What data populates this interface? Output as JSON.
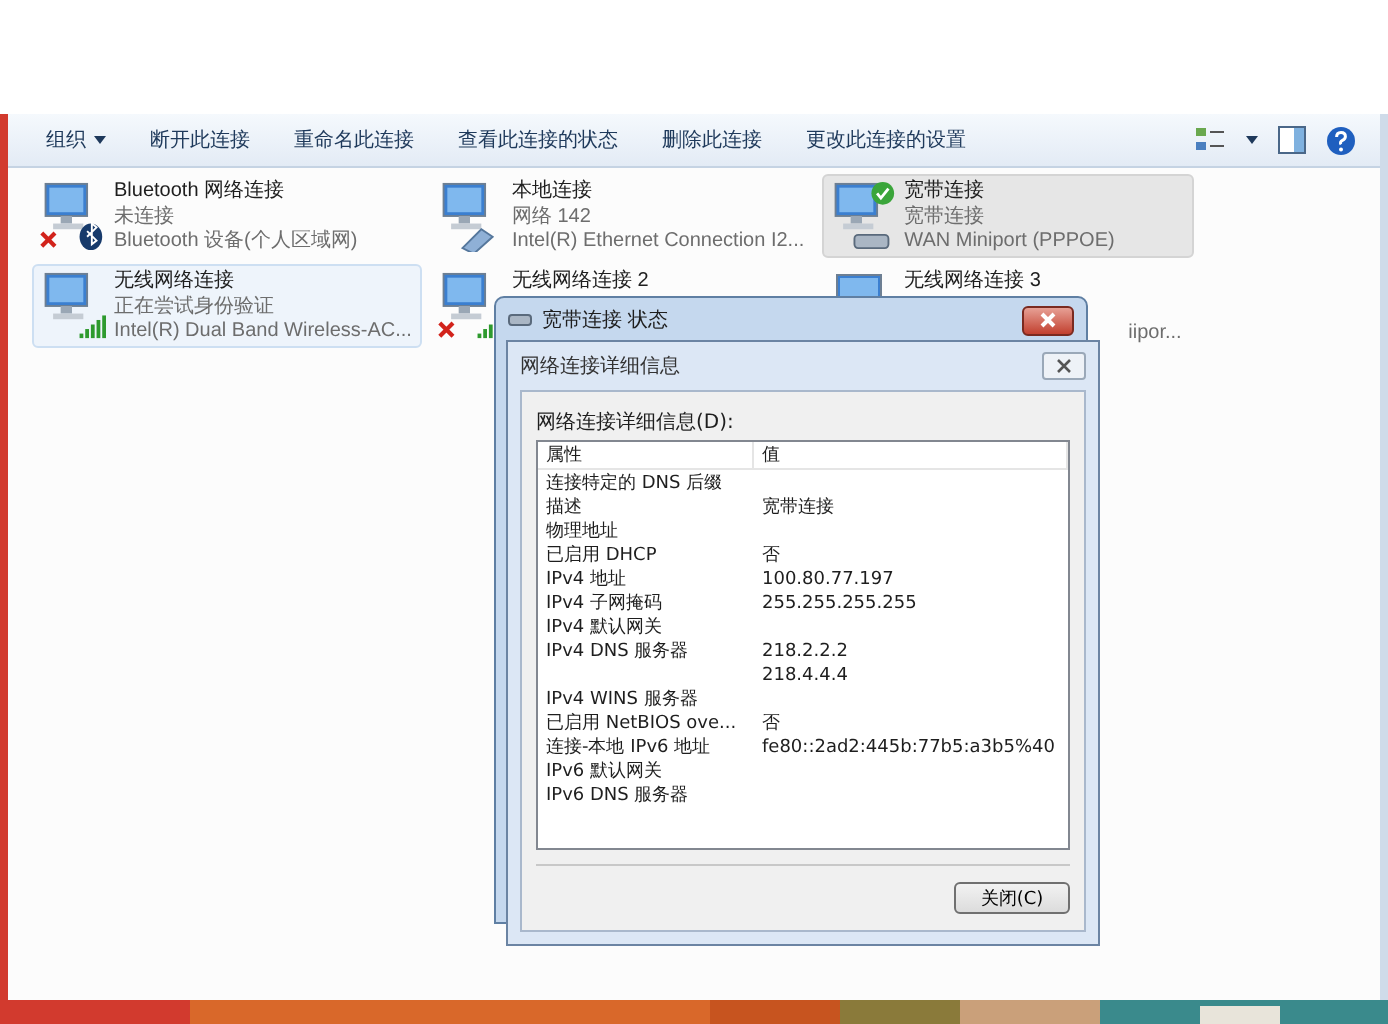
{
  "toolbar": {
    "items": [
      {
        "label": "组织",
        "dropdown": true
      },
      {
        "label": "断开此连接",
        "dropdown": false
      },
      {
        "label": "重命名此连接",
        "dropdown": false
      },
      {
        "label": "查看此连接的状态",
        "dropdown": false
      },
      {
        "label": "删除此连接",
        "dropdown": false
      },
      {
        "label": "更改此连接的设置",
        "dropdown": false
      }
    ]
  },
  "connections": [
    {
      "name": "Bluetooth 网络连接",
      "status": "未连接",
      "device": "Bluetooth 设备(个人区域网)",
      "kind": "bluetooth",
      "disconnected": true,
      "selected": false
    },
    {
      "name": "本地连接",
      "status": "网络  142",
      "device": "Intel(R) Ethernet Connection I2...",
      "kind": "ethernet",
      "disconnected": false,
      "selected": false
    },
    {
      "name": "宽带连接",
      "status": "宽带连接",
      "device": "WAN Miniport (PPPOE)",
      "kind": "broadband",
      "disconnected": false,
      "selected": true
    },
    {
      "name": "无线网络连接",
      "status": "正在尝试身份验证",
      "device": "Intel(R) Dual Band Wireless-AC...",
      "kind": "wireless",
      "disconnected": false,
      "selected": true
    },
    {
      "name": "无线网络连接 2",
      "kind": "wireless",
      "disconnected": true,
      "selected": false
    },
    {
      "name": "无线网络连接 3",
      "device_tail": "iipor...",
      "kind": "wireless"
    }
  ],
  "status_window": {
    "title": "宽带连接 状态"
  },
  "details_dialog": {
    "title": "网络连接详细信息",
    "list_label": "网络连接详细信息(D):",
    "columns": [
      "属性",
      "值"
    ],
    "rows": [
      {
        "property": "连接特定的 DNS 后缀",
        "value": ""
      },
      {
        "property": "描述",
        "value": "宽带连接"
      },
      {
        "property": "物理地址",
        "value": ""
      },
      {
        "property": "已启用 DHCP",
        "value": "否"
      },
      {
        "property": "IPv4 地址",
        "value": "100.80.77.197"
      },
      {
        "property": "IPv4 子网掩码",
        "value": "255.255.255.255"
      },
      {
        "property": "IPv4 默认网关",
        "value": ""
      },
      {
        "property": "IPv4 DNS 服务器",
        "value": "218.2.2.2"
      },
      {
        "property": "",
        "value": "218.4.4.4"
      },
      {
        "property": "IPv4 WINS 服务器",
        "value": ""
      },
      {
        "property": "已启用 NetBIOS ove...",
        "value": "否"
      },
      {
        "property": "连接-本地 IPv6 地址",
        "value": "fe80::2ad2:445b:77b5:a3b5%40"
      },
      {
        "property": "IPv6 默认网关",
        "value": ""
      },
      {
        "property": "IPv6 DNS 服务器",
        "value": ""
      }
    ],
    "close_button": "关闭(C)"
  }
}
